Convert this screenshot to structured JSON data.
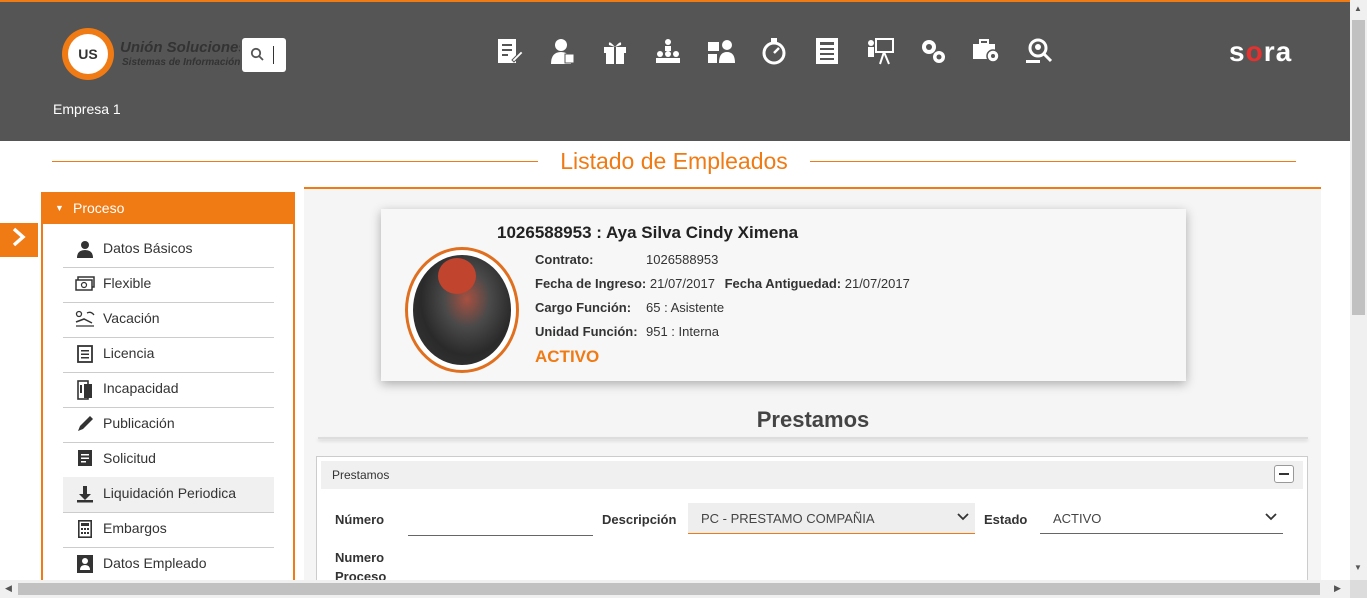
{
  "brand": {
    "logo_text": "UNIÓN US",
    "title": "Unión Soluciones",
    "subtitle": "Sistemas de Información",
    "product": "sora"
  },
  "header": {
    "company": "Empresa 1",
    "nav_icons": [
      "form-edit-icon",
      "employee-icon",
      "gift-icon",
      "organization-icon",
      "hierarchy-icon",
      "stopwatch-icon",
      "report-icon",
      "presentation-icon",
      "settings-gears-icon",
      "briefcase-location-icon",
      "search-users-icon"
    ]
  },
  "page": {
    "title": "Listado de Empleados"
  },
  "sidebar": {
    "section": "Proceso",
    "items": [
      {
        "label": "Datos Básicos",
        "icon": "person-icon"
      },
      {
        "label": "Flexible",
        "icon": "money-icon"
      },
      {
        "label": "Vacación",
        "icon": "beach-icon"
      },
      {
        "label": "Licencia",
        "icon": "list-icon"
      },
      {
        "label": "Incapacidad",
        "icon": "medical-icon"
      },
      {
        "label": "Publicación",
        "icon": "pen-icon"
      },
      {
        "label": "Solicitud",
        "icon": "document-icon"
      },
      {
        "label": "Liquidación Periodica",
        "icon": "download-icon"
      },
      {
        "label": "Embargos",
        "icon": "calculator-icon"
      },
      {
        "label": "Datos Empleado",
        "icon": "id-card-icon"
      }
    ]
  },
  "employee": {
    "name": "1026588953 : Aya Silva Cindy Ximena",
    "contrato_label": "Contrato:",
    "contrato": "1026588953",
    "ingreso_label": "Fecha de Ingreso:",
    "ingreso": "21/07/2017",
    "antiguedad_label": "Fecha Antiguedad:",
    "antiguedad": "21/07/2017",
    "cargo_label": "Cargo Función:",
    "cargo": "65 : Asistente",
    "unidad_label": "Unidad Función:",
    "unidad": "951 : Interna",
    "status": "ACTIVO"
  },
  "prestamos": {
    "section_title": "Prestamos",
    "panel_title": "Prestamos",
    "numero_label": "Número",
    "numero_value": "",
    "descripcion_label": "Descripción",
    "descripcion_value": "PC - PRESTAMO COMPAÑIA",
    "estado_label": "Estado",
    "estado_value": "ACTIVO",
    "numero_proceso_label_1": "Numero",
    "numero_proceso_label_2": "Proceso"
  },
  "colors": {
    "accent": "#f07a13",
    "header_bg": "#555555",
    "brand_red": "#e8302f"
  }
}
